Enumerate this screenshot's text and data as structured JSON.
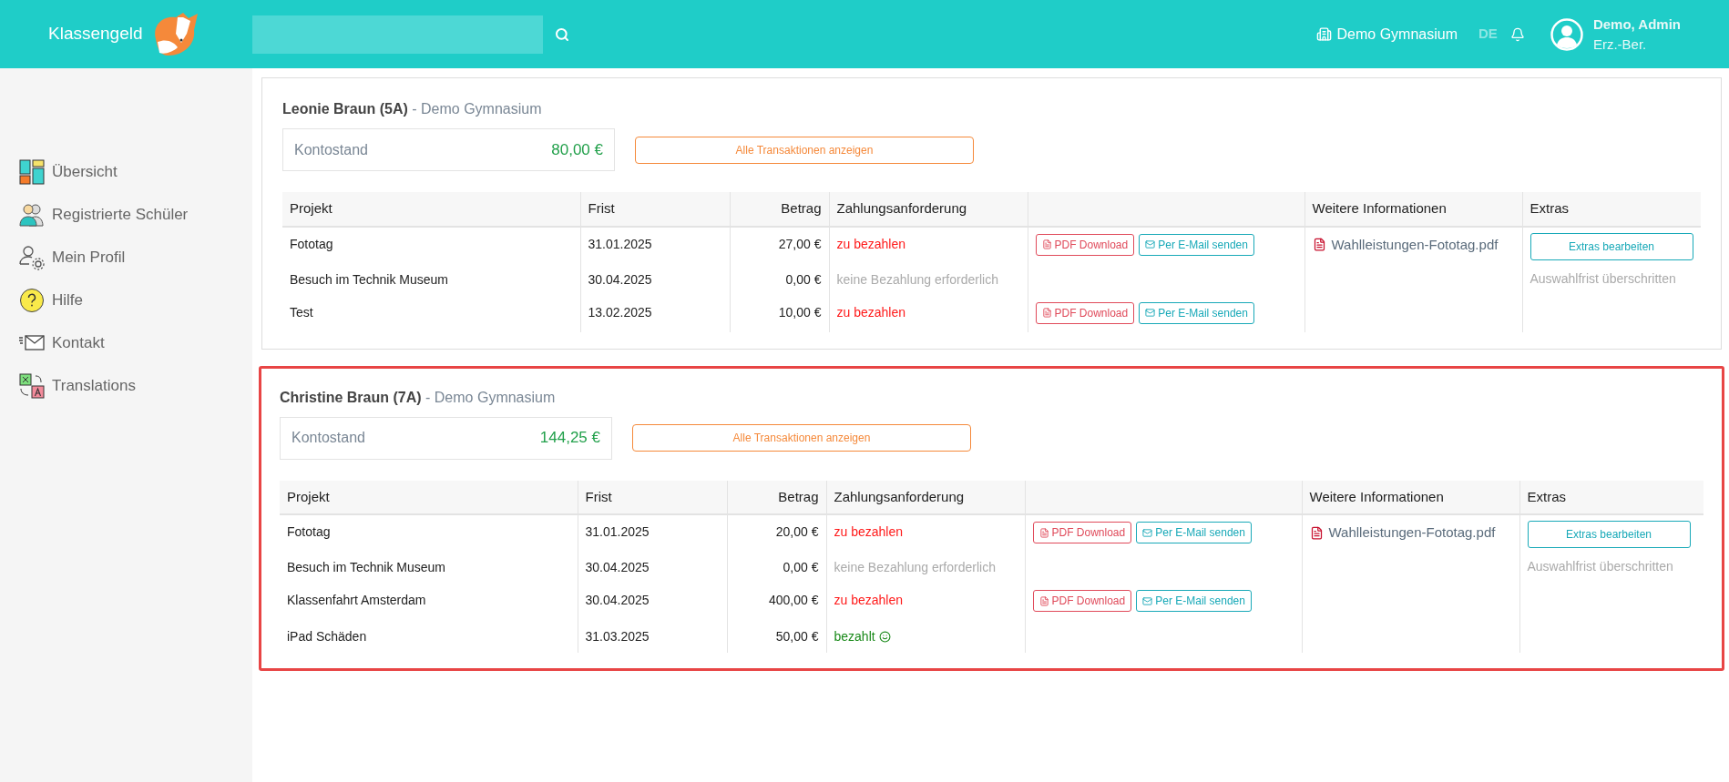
{
  "header": {
    "logo_text": "Klassengeld",
    "school": "Demo Gymnasium",
    "language": {
      "label": "DE",
      "selected": true
    },
    "user": {
      "name": "Demo, Admin",
      "role": "Erz.-Ber."
    }
  },
  "sidebar": {
    "items": [
      {
        "label": "Übersicht",
        "kind": "dashboard"
      },
      {
        "label": "Registrierte Schüler",
        "kind": "users"
      },
      {
        "label": "Mein Profil",
        "kind": "profile"
      },
      {
        "label": "Hilfe",
        "kind": "help"
      },
      {
        "label": "Kontakt",
        "kind": "mail"
      },
      {
        "label": "Translations",
        "kind": "translate"
      }
    ]
  },
  "students": [
    {
      "name": "Leonie Braun (5A)",
      "school": "- Demo Gymnasium",
      "highlighted": false,
      "balance_label": "Kontostand",
      "balance": "80,00 €",
      "transactions_button": "Alle Transaktionen anzeigen",
      "columns": [
        "Projekt",
        "Frist",
        "Betrag",
        "Zahlungsanforderung",
        "Weitere Informationen",
        "Extras"
      ],
      "rows": [
        {
          "project": "Fototag",
          "deadline": "31.01.2025",
          "amount": "27,00 €",
          "status": "zu bezahlen",
          "kind": "due",
          "pdf_button": "PDF Download",
          "email_button": "Per E-Mail senden"
        },
        {
          "project": "Besuch im Technik Museum",
          "deadline": "30.04.2025",
          "amount": "0,00 €",
          "status": "keine Bezahlung erforderlich",
          "kind": "none"
        },
        {
          "project": "Test",
          "deadline": "13.02.2025",
          "amount": "10,00 €",
          "status": "zu bezahlen",
          "kind": "due",
          "pdf_button": "PDF Download",
          "email_button": "Per E-Mail senden"
        }
      ],
      "info_file": "Wahlleistungen-Fototag.pdf",
      "extras_button": "Extras bearbeiten",
      "extras_note": "Auswahlfrist überschritten"
    },
    {
      "name": "Christine Braun (7A)",
      "school": "- Demo Gymnasium",
      "highlighted": true,
      "balance_label": "Kontostand",
      "balance": "144,25 €",
      "transactions_button": "Alle Transaktionen anzeigen",
      "columns": [
        "Projekt",
        "Frist",
        "Betrag",
        "Zahlungsanforderung",
        "Weitere Informationen",
        "Extras"
      ],
      "rows": [
        {
          "project": "Fototag",
          "deadline": "31.01.2025",
          "amount": "20,00 €",
          "status": "zu bezahlen",
          "kind": "due",
          "pdf_button": "PDF Download",
          "email_button": "Per E-Mail senden"
        },
        {
          "project": "Besuch im Technik Museum",
          "deadline": "30.04.2025",
          "amount": "0,00 €",
          "status": "keine Bezahlung erforderlich",
          "kind": "none"
        },
        {
          "project": "Klassenfahrt Amsterdam",
          "deadline": "30.04.2025",
          "amount": "400,00 €",
          "status": "zu bezahlen",
          "kind": "due",
          "pdf_button": "PDF Download",
          "email_button": "Per E-Mail senden"
        },
        {
          "project": "iPad Schäden",
          "deadline": "31.03.2025",
          "amount": "50,00 €",
          "status": "bezahlt",
          "kind": "paid"
        }
      ],
      "info_file": "Wahlleistungen-Fototag.pdf",
      "extras_button": "Extras bearbeiten",
      "extras_note": "Auswahlfrist überschritten"
    }
  ]
}
